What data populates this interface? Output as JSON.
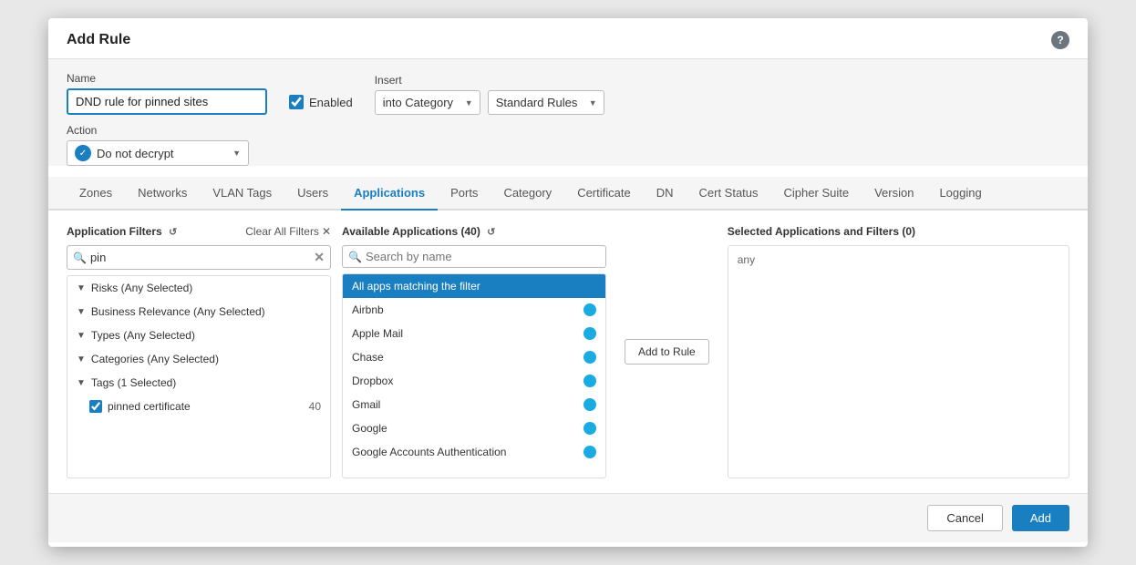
{
  "modal": {
    "title": "Add Rule",
    "help_icon": "?"
  },
  "form": {
    "name_label": "Name",
    "name_value": "DND rule for pinned sites",
    "enabled_label": "Enabled",
    "insert_label": "Insert",
    "insert_option": "into Category",
    "standard_rules_option": "Standard Rules",
    "action_label": "Action",
    "action_option": "Do not decrypt"
  },
  "tabs": [
    {
      "label": "Zones",
      "active": false
    },
    {
      "label": "Networks",
      "active": false
    },
    {
      "label": "VLAN Tags",
      "active": false
    },
    {
      "label": "Users",
      "active": false
    },
    {
      "label": "Applications",
      "active": true
    },
    {
      "label": "Ports",
      "active": false
    },
    {
      "label": "Category",
      "active": false
    },
    {
      "label": "Certificate",
      "active": false
    },
    {
      "label": "DN",
      "active": false
    },
    {
      "label": "Cert Status",
      "active": false
    },
    {
      "label": "Cipher Suite",
      "active": false
    },
    {
      "label": "Version",
      "active": false
    },
    {
      "label": "Logging",
      "active": false
    }
  ],
  "left_panel": {
    "title": "Application Filters",
    "refresh_icon": "↺",
    "clear_all_label": "Clear All Filters",
    "clear_icon": "✕",
    "search_value": "pin",
    "filters": [
      {
        "label": "Risks (Any Selected)",
        "type": "group"
      },
      {
        "label": "Business Relevance (Any Selected)",
        "type": "group"
      },
      {
        "label": "Types (Any Selected)",
        "type": "group"
      },
      {
        "label": "Categories (Any Selected)",
        "type": "group"
      },
      {
        "label": "Tags (1 Selected)",
        "type": "group",
        "expanded": true
      }
    ],
    "tag_item": {
      "label": "pinned certificate",
      "count": 40,
      "checked": true
    }
  },
  "mid_panel": {
    "title": "Available Applications (40)",
    "refresh_icon": "↺",
    "search_placeholder": "Search by name",
    "apps": [
      {
        "label": "All apps matching the filter",
        "selected": true,
        "dot": false
      },
      {
        "label": "Airbnb",
        "selected": false,
        "dot": true
      },
      {
        "label": "Apple Mail",
        "selected": false,
        "dot": true
      },
      {
        "label": "Chase",
        "selected": false,
        "dot": true
      },
      {
        "label": "Dropbox",
        "selected": false,
        "dot": true
      },
      {
        "label": "Gmail",
        "selected": false,
        "dot": true
      },
      {
        "label": "Google",
        "selected": false,
        "dot": true
      },
      {
        "label": "Google Accounts Authentication",
        "selected": false,
        "dot": true
      }
    ],
    "add_to_rule_label": "Add to Rule"
  },
  "right_panel": {
    "title": "Selected Applications and Filters (0)",
    "any_label": "any"
  },
  "footer": {
    "cancel_label": "Cancel",
    "add_label": "Add"
  }
}
